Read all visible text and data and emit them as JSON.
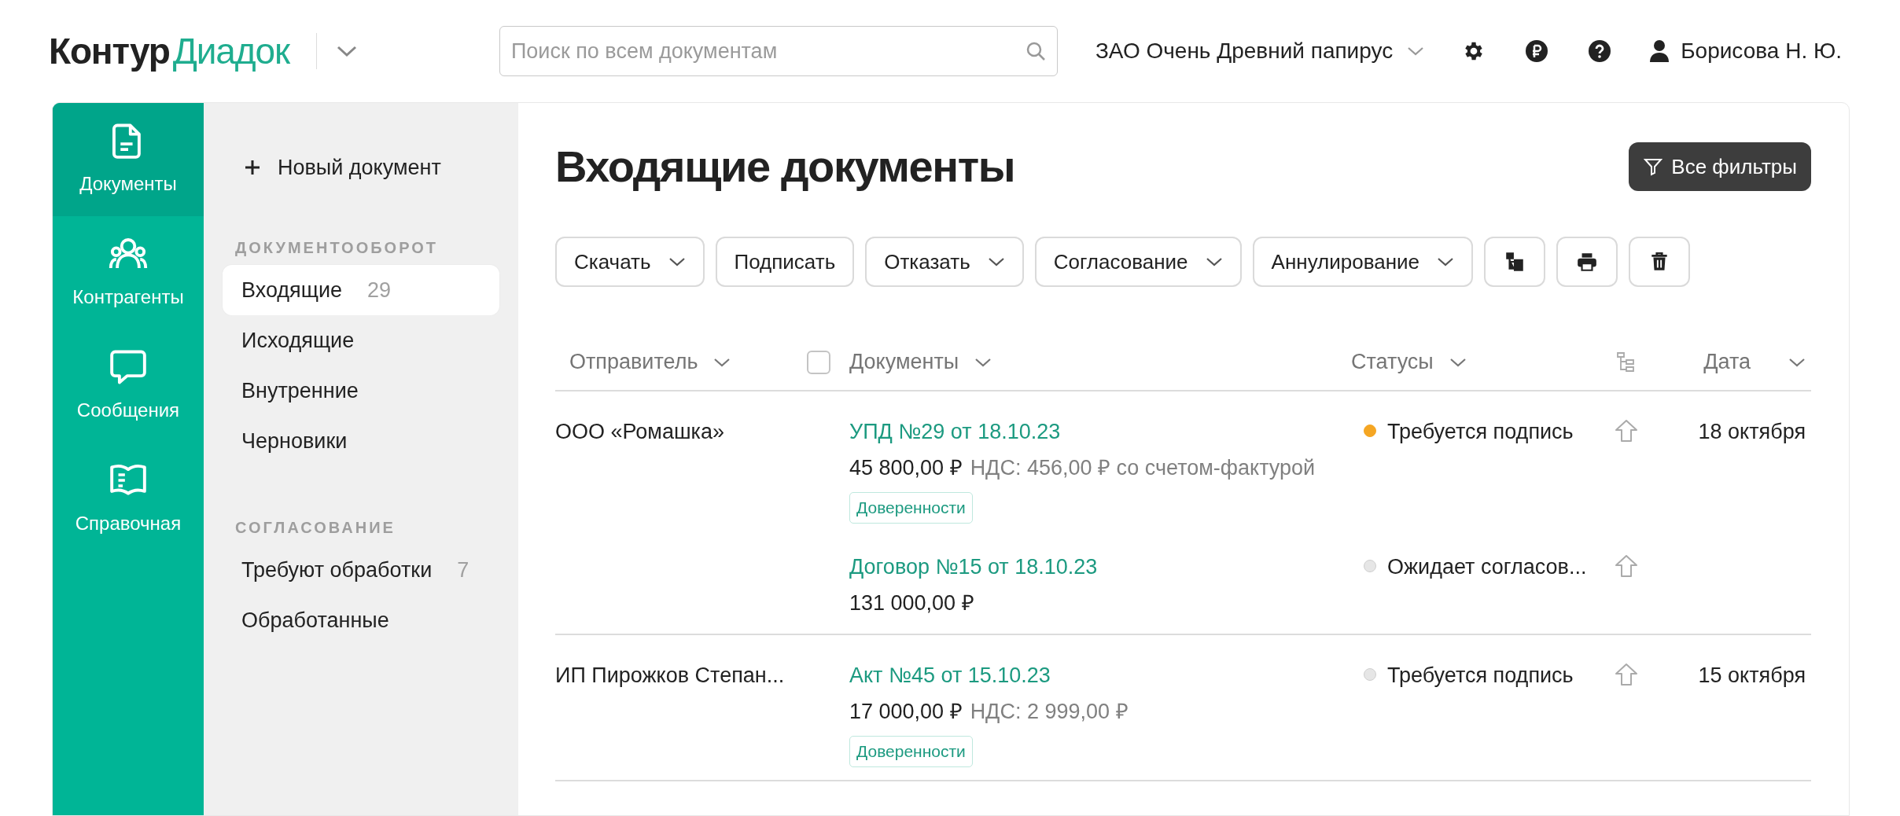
{
  "header": {
    "logo_first": "Контур",
    "logo_second": "Диадок",
    "search": {
      "placeholder": "Поиск по всем документам"
    },
    "organization": "ЗАО Очень Древний папирус",
    "user": "Борисова Н. Ю."
  },
  "rail": [
    {
      "label": "Документы",
      "selected": true
    },
    {
      "label": "Контрагенты",
      "selected": false
    },
    {
      "label": "Сообщения",
      "selected": false
    },
    {
      "label": "Справочная",
      "selected": false
    }
  ],
  "sidebar": {
    "new_document": "Новый документ",
    "sections": [
      {
        "title": "ДОКУМЕНТООБОРОТ",
        "items": [
          {
            "label": "Входящие",
            "count": "29",
            "selected": true
          },
          {
            "label": "Исходящие",
            "selected": false
          },
          {
            "label": "Внутренние",
            "selected": false
          },
          {
            "label": "Черновики",
            "selected": false
          }
        ]
      },
      {
        "title": "СОГЛАСОВАНИЕ",
        "items": [
          {
            "label": "Требуют обработки",
            "count": "7",
            "selected": false
          },
          {
            "label": "Обработанные",
            "selected": false
          }
        ]
      }
    ]
  },
  "page_title": "Входящие документы",
  "filters_button": "Все фильтры",
  "toolbar": [
    {
      "kind": "menu",
      "label": "Скачать"
    },
    {
      "kind": "plain",
      "label": "Подписать"
    },
    {
      "kind": "menu",
      "label": "Отказать"
    },
    {
      "kind": "menu",
      "label": "Согласование"
    },
    {
      "kind": "menu",
      "label": "Аннулирование"
    },
    {
      "kind": "structure"
    },
    {
      "kind": "print"
    },
    {
      "kind": "delete"
    }
  ],
  "table": {
    "columns": {
      "sender": "Отправитель",
      "select_all": {
        "checked": false
      },
      "documents": "Документы",
      "statuses": "Статусы",
      "date": "Дата"
    },
    "rows": [
      {
        "sender": "ООО «Ромашка»",
        "documents": [
          {
            "title": "УПД №29 от 18.10.23",
            "amount": "45 800,00 ₽",
            "vat": "НДС: 456,00 ₽ со счетом-фактурой",
            "tag": "Доверенности",
            "status": "Требуется подпись",
            "color": "#f5a623",
            "date": "18 октября"
          },
          {
            "title": "Договор №15 от 18.10.23",
            "amount": "131 000,00 ₽",
            "status": "Ожидает согласов...",
            "color": "#e6e6e6"
          }
        ]
      },
      {
        "sender": "ИП Пирожков Степан...",
        "documents": [
          {
            "title": "Акт №45 от 15.10.23",
            "amount": "17 000,00 ₽",
            "vat": "НДС: 2 999,00 ₽",
            "tag": "Доверенности",
            "status": "Требуется подпись",
            "color": "#e6e6e6",
            "date": "15 октября"
          }
        ]
      }
    ]
  }
}
